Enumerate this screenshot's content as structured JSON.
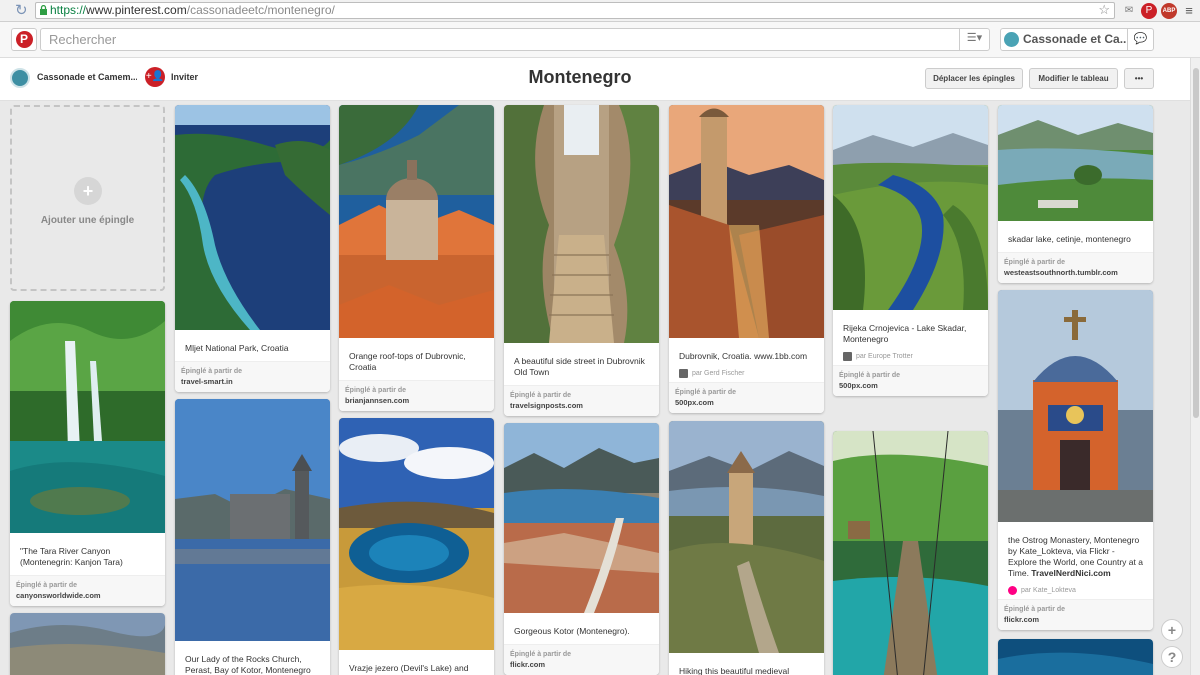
{
  "browser": {
    "url_scheme": "https://",
    "url_host": "www.pinterest.com",
    "url_path": "/cassonadeetc/montenegro/",
    "extensions": [
      {
        "name": "mail-icon",
        "glyph": "✉",
        "color": "#777777"
      },
      {
        "name": "pinterest-ext-icon",
        "glyph": "P",
        "color": "#cb2027"
      },
      {
        "name": "adblock-icon",
        "glyph": "ABP",
        "color": "#c0392b"
      }
    ]
  },
  "header": {
    "search_placeholder": "Rechercher",
    "user_name": "Cassonade et Ca...",
    "logo_letter": "P"
  },
  "board": {
    "owner": "Cassonade et Camem...",
    "invite": "Inviter",
    "title": "Montenegro",
    "move_pins": "Déplacer les épingles",
    "edit_board": "Modifier le tableau",
    "more": "•••",
    "add_pin": "Ajouter une épingle"
  },
  "pins": [
    {
      "id": "tara",
      "desc": "\"The Tara River Canyon (Montenegrin: Kanjon Tara)",
      "via_label": "Épinglé à partir de",
      "domain": "canyonsworldwide.com"
    },
    {
      "id": "mljet",
      "desc": "Mljet National Park, Croatia",
      "via_label": "Épinglé à partir de",
      "domain": "travel-smart.in"
    },
    {
      "id": "perast",
      "desc": "Our Lady of the Rocks Church, Perast, Bay of Kotor, Montenegro"
    },
    {
      "id": "dubrovnik-roofs",
      "desc": "Orange roof-tops of Dubrovnic, Croatia",
      "via_label": "Épinglé à partir de",
      "domain": "brianjannsen.com"
    },
    {
      "id": "vrazje",
      "desc": "Vrazje jezero (Devil's Lake) and Riblje jezero (Fish Lake) in"
    },
    {
      "id": "side-street",
      "desc": "A beautiful side street in Dubrovnik Old Town",
      "via_label": "Épinglé à partir de",
      "domain": "travelsignposts.com"
    },
    {
      "id": "kotor",
      "desc": "Gorgeous Kotor (Montenegro).",
      "via_label": "Épinglé à partir de",
      "domain": "flickr.com"
    },
    {
      "id": "dubrovnik-1bb",
      "desc": "Dubrovnik, Croatia. www.1bb.com",
      "by": "par Gerd Fischer",
      "via_label": "Épinglé à partir de",
      "domain": "500px.com"
    },
    {
      "id": "hiking",
      "desc": "Hiking this beautiful medieval"
    },
    {
      "id": "crnojevica",
      "desc": "Rijeka Crnojevica - Lake Skadar, Montenegro",
      "by": "par Europe Trotter",
      "via_label": "Épinglé à partir de",
      "domain": "500px.com"
    },
    {
      "id": "skadar",
      "desc": "skadar lake, cetinje, montenegro",
      "via_label": "Épinglé à partir de",
      "domain": "westeastsouthnorth.tumblr.com"
    },
    {
      "id": "ostrog",
      "desc_pre": "the Ostrog Monastery, Montenegro by Kate_Lokteva, via Flickr - Explore the World, one Country at a Time. ",
      "desc_bold": "TravelNerdNici.com",
      "by": "par Kate_Lokteva",
      "via_label": "Épinglé à partir de",
      "domain": "flickr.com"
    }
  ],
  "fab": {
    "add": "+",
    "help": "?"
  }
}
